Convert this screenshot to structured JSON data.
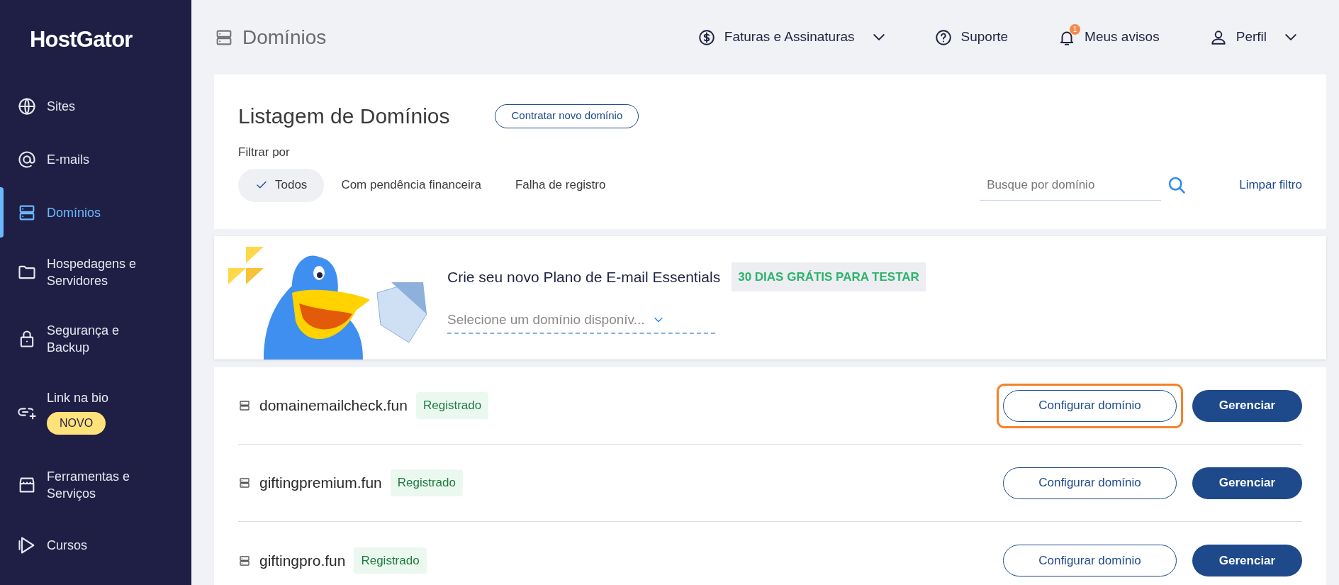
{
  "sidebar": {
    "logo": "HostGator",
    "items": [
      {
        "label": "Sites",
        "selected": false
      },
      {
        "label": "E-mails",
        "selected": false
      },
      {
        "label": "Domínios",
        "selected": true
      },
      {
        "label": "Hospedagens e Servidores",
        "selected": false
      },
      {
        "label": "Segurança e Backup",
        "selected": false
      },
      {
        "label": "Link na bio",
        "badge": "NOVO",
        "selected": false
      },
      {
        "label": "Ferramentas e Serviços",
        "selected": false
      },
      {
        "label": "Cursos",
        "selected": false
      }
    ]
  },
  "header": {
    "title": "Domínios",
    "nav": [
      {
        "label": "Faturas e Assinaturas",
        "dropdown": true
      },
      {
        "label": "Suporte",
        "dropdown": false
      },
      {
        "label": "Meus avisos",
        "count": "1",
        "dropdown": false
      },
      {
        "label": "Perfil",
        "dropdown": true
      }
    ]
  },
  "listing": {
    "title": "Listagem de Domínios",
    "new_button": "Contratar novo domínio",
    "filter_label": "Filtrar por",
    "filters": [
      {
        "label": "Todos",
        "selected": true
      },
      {
        "label": "Com pendência financeira",
        "selected": false
      },
      {
        "label": "Falha de registro",
        "selected": false
      }
    ],
    "search": {
      "placeholder": "Busque por domínio"
    },
    "clear": "Limpar filtro"
  },
  "banner": {
    "text": "Crie seu novo Plano de E-mail Essentials",
    "tag": "30 DIAS GRÁTIS PARA TESTAR",
    "select": {
      "placeholder": "Selecione um domínio disponív..."
    }
  },
  "domains": [
    {
      "name": "domainemailcheck.fun",
      "status": "Registrado",
      "configure": "Configurar domínio",
      "manage": "Gerenciar",
      "highlighted": true
    },
    {
      "name": "giftingpremium.fun",
      "status": "Registrado",
      "configure": "Configurar domínio",
      "manage": "Gerenciar",
      "highlighted": false
    },
    {
      "name": "giftingpro.fun",
      "status": "Registrado",
      "configure": "Configurar domínio",
      "manage": "Gerenciar",
      "highlighted": false
    }
  ]
}
